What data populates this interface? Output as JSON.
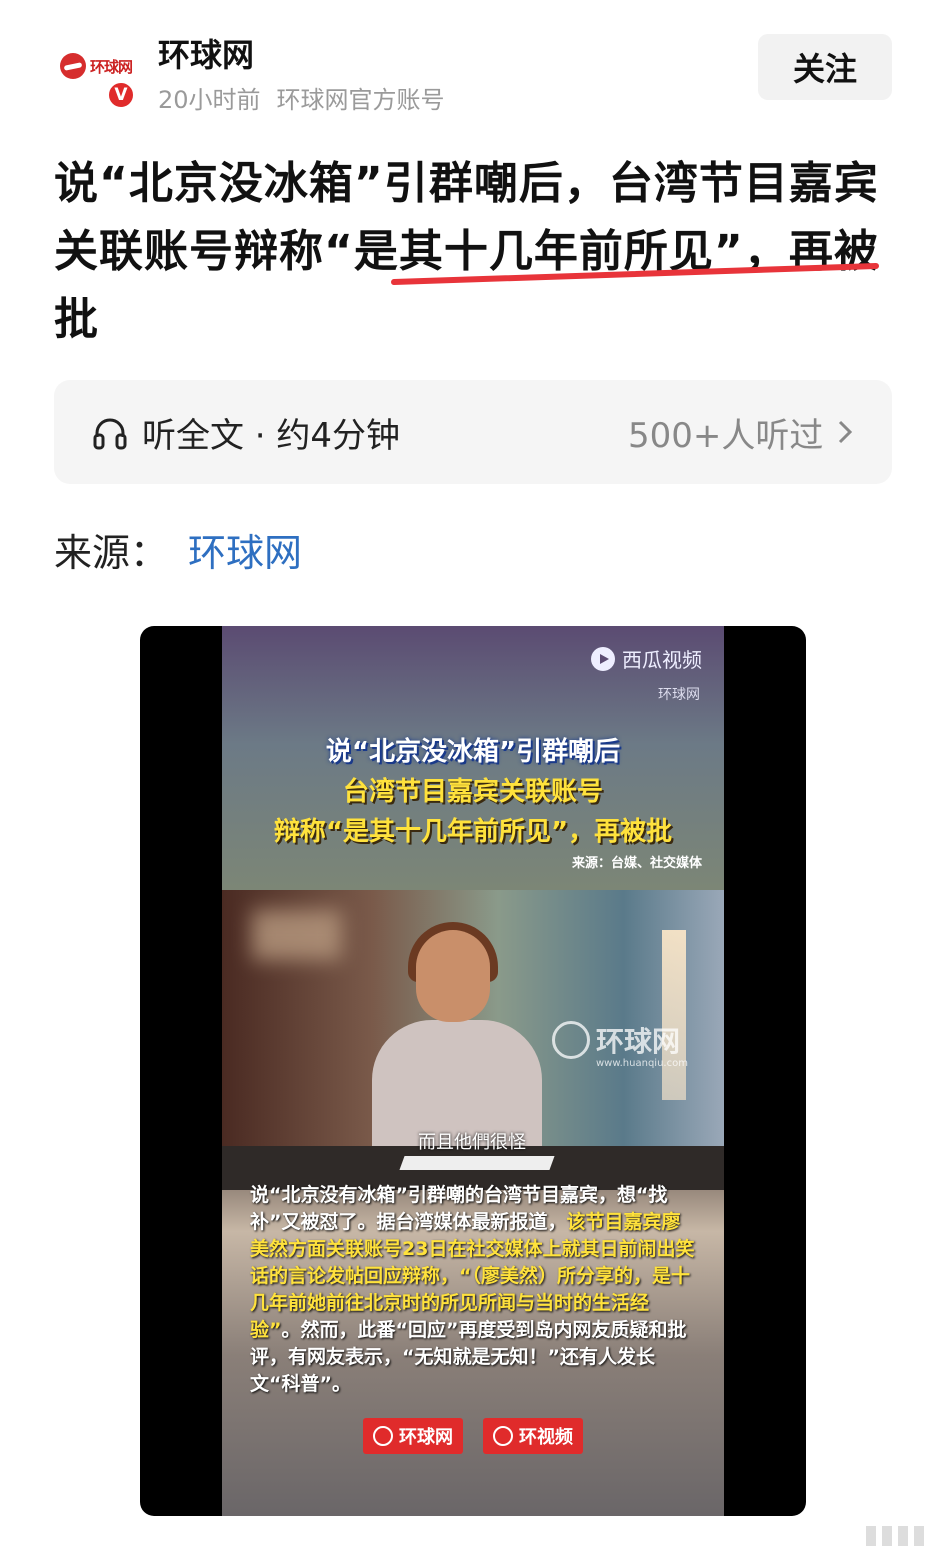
{
  "author": {
    "logo_text": "环球网",
    "verified_label": "V",
    "name": "环球网",
    "time": "20小时前",
    "account_type": "环球网官方账号",
    "follow_label": "关注"
  },
  "article": {
    "title_part1": "说“北京没冰箱”引群嘲后，台湾节目嘉宾关联账号辩称“",
    "title_highlight": "是其十几年前所见”",
    "title_part2": "，再被批"
  },
  "listen": {
    "label": "听全文 · 约4分钟",
    "count": "500+人听过"
  },
  "source": {
    "label": "来源：",
    "link": "环球网"
  },
  "video": {
    "platform": "西瓜视频",
    "channel": "环球网",
    "headline_1": "说“北京没冰箱”引群嘲后",
    "headline_2": "台湾节目嘉宾关联账号",
    "headline_3": "辩称“是其十几年前所见”，再被批",
    "source_note": "来源：台媒、社交媒体",
    "subtitle": "而且他們很怪",
    "watermark": "环球网",
    "watermark_url": "www.huanqiu.com",
    "body_a": "说“北京没有冰箱”引群嘲的台湾节目嘉宾，想“找补”又被怼了。据台湾媒体最新报道，",
    "body_b": "该节目嘉宾廖美然方面关联账号23日在社交媒体上就其日前闹出笑话的言论发帖回应辩称，“（廖美然）所分享的，是十几年前她前往北京时的所见所闻与当时的生活经验”",
    "body_c": "。然而，此番“回应”再度受到岛内网友质疑和批评，有网友表示，“无知就是无知！”还有人发长文“科普”。",
    "logo_1": "环球网",
    "logo_2": "环视频"
  },
  "colors": {
    "link": "#2e6fc1",
    "underline": "#e8343a",
    "caption_yellow": "#ffe23c",
    "brand_red": "#e02b2b"
  }
}
